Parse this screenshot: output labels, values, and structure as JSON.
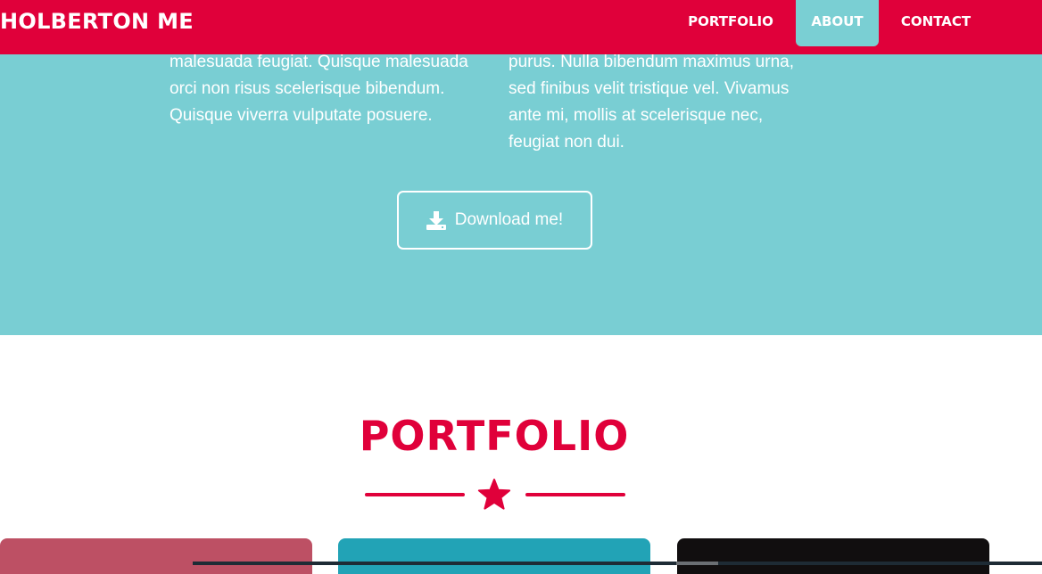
{
  "navbar": {
    "brand": "HOLBERTON ME",
    "items": [
      {
        "label": "PORTFOLIO",
        "active": false
      },
      {
        "label": "ABOUT",
        "active": true
      },
      {
        "label": "CONTACT",
        "active": false
      }
    ],
    "colors": {
      "background": "#e0003a",
      "active_item": "#7acfd3"
    }
  },
  "about": {
    "background": "#79ced3",
    "left_lines": [
      "malesuada feugiat. Quisque malesuada",
      "orci non risus scelerisque bibendum.",
      "Quisque viverra vulputate posuere."
    ],
    "right_lines": [
      "purus. Nulla bibendum maximus urna,",
      "sed finibus velit tristique vel. Vivamus",
      "ante mi, mollis at scelerisque nec,",
      "feugiat non dui."
    ],
    "download_button": {
      "label": "Download me!",
      "icon": "download-icon"
    }
  },
  "portfolio": {
    "title": "PORTFOLIO",
    "divider_icon": "star-icon",
    "accent": "#e0003a",
    "cards": [
      {
        "color": "#bd5064"
      },
      {
        "color": "#22a3b6"
      },
      {
        "color": "#110e0f"
      }
    ]
  }
}
